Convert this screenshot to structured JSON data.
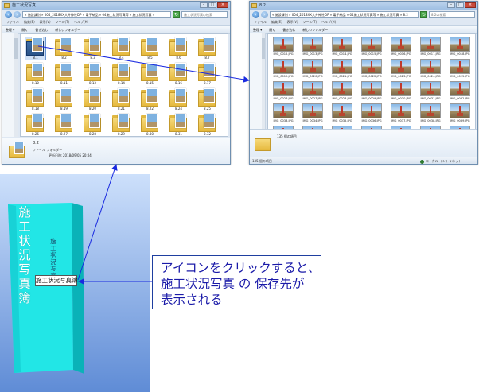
{
  "left_window": {
    "title": "施工状況写真",
    "address": "« 施設課別 » 004_2018XX大井神社DP » 電子納品 » 04施工状況写真等 » 施工状況写真 »",
    "search_placeholder": "施工状況写真の検索",
    "menu": [
      "ファイル",
      "編集(E)",
      "表示(V)",
      "ツール(T)",
      "ヘルプ(H)"
    ],
    "toolbar": [
      "整理 ▾",
      "開く",
      "書き込む",
      "新しいフォルダー"
    ],
    "folders": [
      {
        "label": "8.1",
        "selected": true
      },
      {
        "label": "8.2"
      },
      {
        "label": "8.3"
      },
      {
        "label": "8.4"
      },
      {
        "label": "8.5"
      },
      {
        "label": "8.6"
      },
      {
        "label": "8.7"
      },
      {
        "label": "8.10"
      },
      {
        "label": "8.11"
      },
      {
        "label": "8.13"
      },
      {
        "label": "8.14"
      },
      {
        "label": "8.15"
      },
      {
        "label": "8.16"
      },
      {
        "label": "8.17"
      },
      {
        "label": "8.18"
      },
      {
        "label": "8.19"
      },
      {
        "label": "8.20"
      },
      {
        "label": "8.21"
      },
      {
        "label": "8.22"
      },
      {
        "label": "8.24"
      },
      {
        "label": "8.25"
      },
      {
        "label": "8.26"
      },
      {
        "label": "8.27"
      },
      {
        "label": "8.28"
      },
      {
        "label": "8.29"
      },
      {
        "label": "8.30"
      },
      {
        "label": "8.31"
      },
      {
        "label": "8.32"
      }
    ],
    "detail": {
      "name": "8.2",
      "type": "ファイル フォルダー",
      "modified_label": "更新日時:",
      "modified_value": "2018/09/05 20:04"
    }
  },
  "right_window": {
    "title": "8.2",
    "address": "« 施設課別 » 004_2018XX大井神社DP » 電子納品 » 04施工状況写真等 » 施工状況写真 » 8.2",
    "search_placeholder": "8.2の検索",
    "menu": [
      "ファイル",
      "編集(E)",
      "表示(V)",
      "ツール(T)",
      "ヘルプ(H)"
    ],
    "toolbar": [
      "整理 ▾",
      "開く",
      "書き込む",
      "新しいフォルダー"
    ],
    "thumbnails": [
      "IMG_0012.JPG",
      "IMG_0013.JPG",
      "IMG_0014.JPG",
      "IMG_0015.JPG",
      "IMG_0016.JPG",
      "IMG_0017.JPG",
      "IMG_0018.JPG",
      "IMG_0019.JPG",
      "IMG_0020.JPG",
      "IMG_0021.JPG",
      "IMG_0022.JPG",
      "IMG_0023.JPG",
      "IMG_0024.JPG",
      "IMG_0025.JPG",
      "IMG_0026.JPG",
      "IMG_0027.JPG",
      "IMG_0028.JPG",
      "IMG_0029.JPG",
      "IMG_0030.JPG",
      "IMG_0031.JPG",
      "IMG_0032.JPG",
      "IMG_0033.JPG",
      "IMG_0034.JPG",
      "IMG_0035.JPG",
      "IMG_0036.JPG",
      "IMG_0037.JPG",
      "IMG_0038.JPG",
      "IMG_0039.JPG",
      "",
      "",
      "",
      "",
      "",
      "",
      ""
    ],
    "detail_count": "135 個の項目",
    "status_left": "135 個の項目",
    "status_zone": "ローカル イントラネット"
  },
  "book": {
    "title": "施工状況写真簿",
    "vertical_title": "施工状況写真簿",
    "spine_label": "施工状況写真簿"
  },
  "callout": {
    "line1": "アイコンをクリックすると、",
    "line2": "施工状況写真 の 保存先が",
    "line3": "表示される"
  },
  "colors": {
    "book_face": "#22e6e6",
    "book_side": "#0ab2b8",
    "arrow": "#1a2ae0",
    "callout_text": "#1a1aa8",
    "background_gradient_top": "#cde0fb",
    "background_gradient_bottom": "#5f8cd6"
  }
}
